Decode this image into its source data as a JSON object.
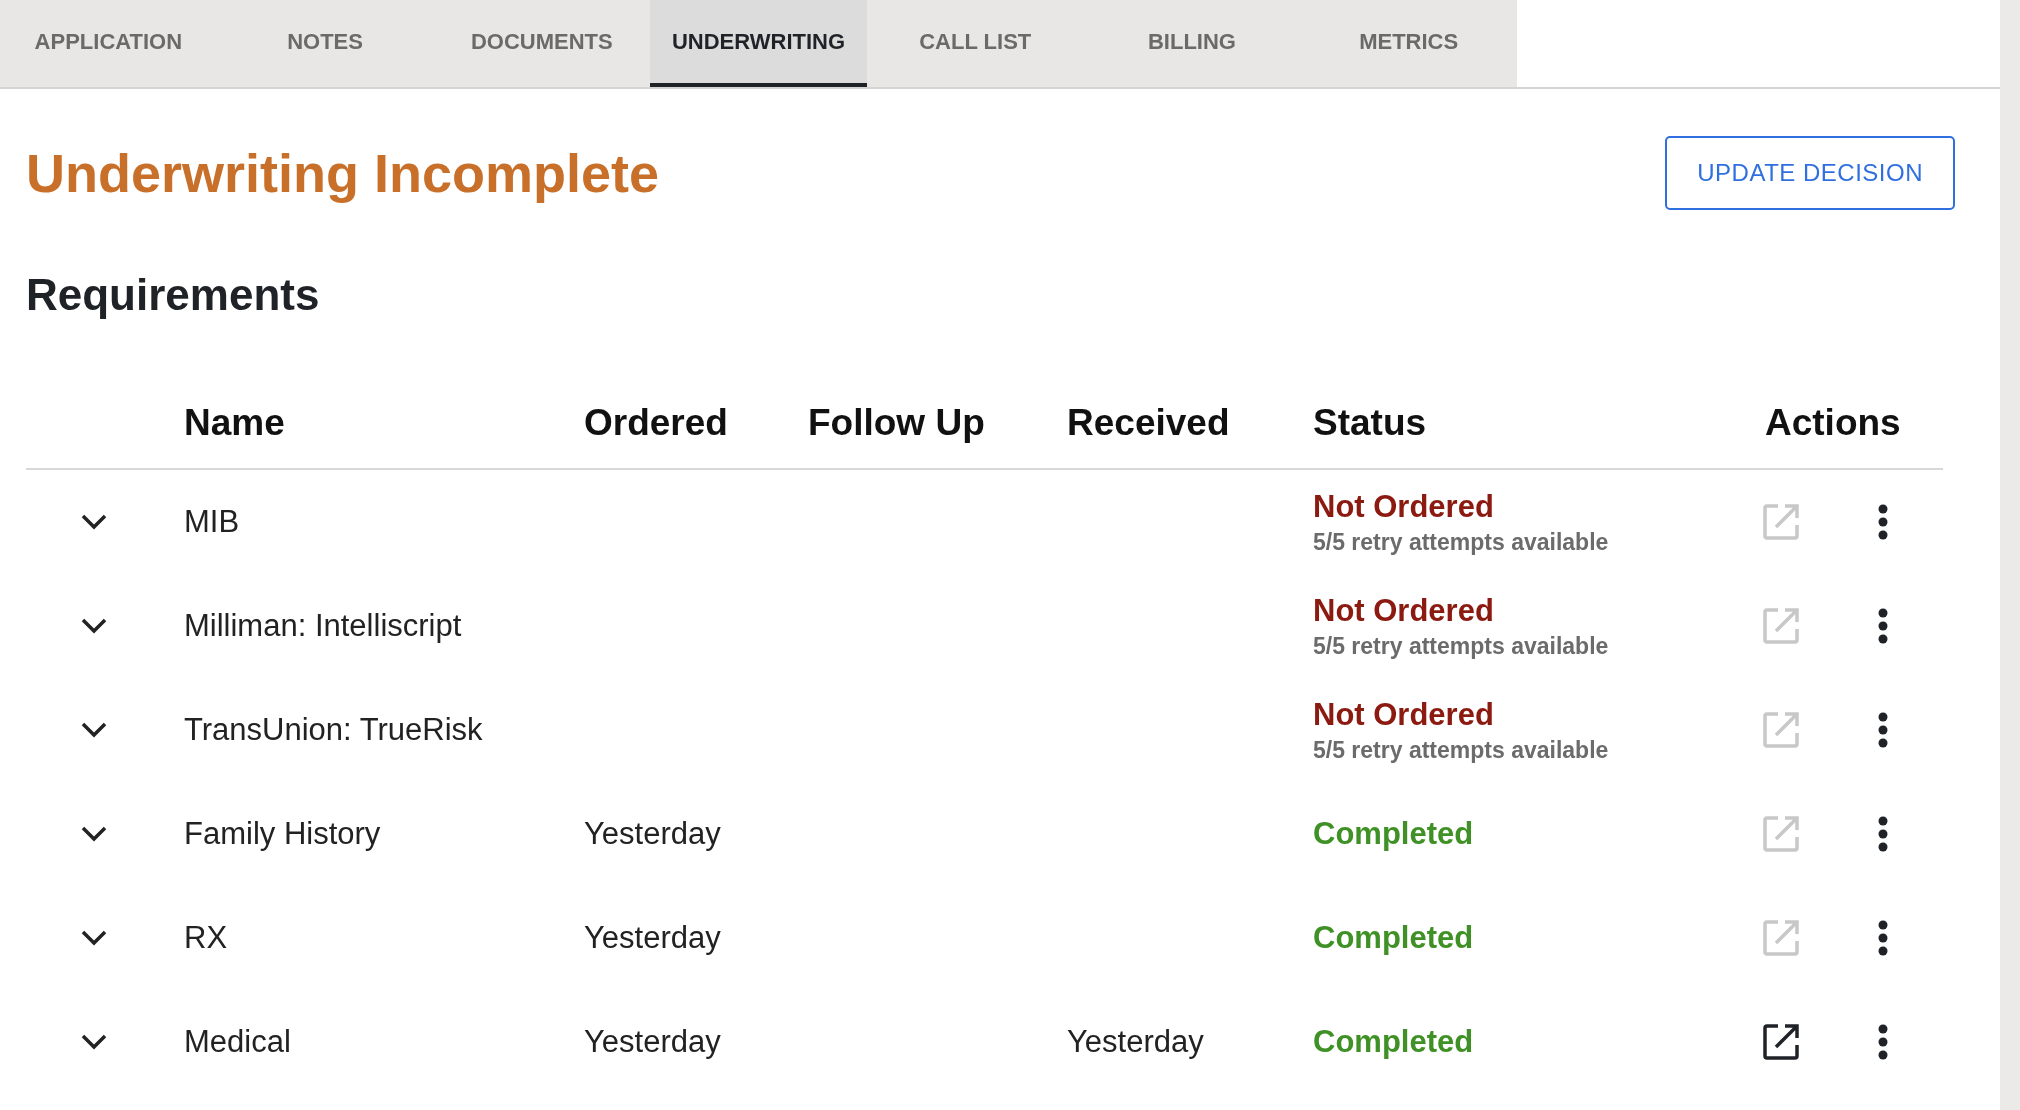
{
  "tabs": [
    {
      "label": "APPLICATION",
      "selected": false
    },
    {
      "label": "NOTES",
      "selected": false
    },
    {
      "label": "DOCUMENTS",
      "selected": false
    },
    {
      "label": "UNDERWRITING",
      "selected": true
    },
    {
      "label": "CALL LIST",
      "selected": false
    },
    {
      "label": "BILLING",
      "selected": false
    },
    {
      "label": "METRICS",
      "selected": false
    }
  ],
  "title": "Underwriting Incomplete",
  "update_button": "UPDATE DECISION",
  "section_title": "Requirements",
  "table": {
    "columns": [
      "Name",
      "Ordered",
      "Follow Up",
      "Received",
      "Status",
      "Actions"
    ],
    "rows": [
      {
        "name": "MIB",
        "status": "Not Ordered",
        "color": "#8b1a10",
        "note": "5/5 retry attempts available",
        "open_disabled": true
      },
      {
        "name": "Milliman: Intelliscript",
        "status": "Not Ordered",
        "color": "#8b1a10",
        "note": "5/5 retry attempts available",
        "open_disabled": true
      },
      {
        "name": "TransUnion: TrueRisk",
        "status": "Not Ordered",
        "color": "#8b1a10",
        "note": "5/5 retry attempts available",
        "open_disabled": true
      },
      {
        "name": "Family History",
        "ordered": "Yesterday",
        "status": "Completed",
        "color": "#3f9126",
        "open_disabled": true
      },
      {
        "name": "RX",
        "ordered": "Yesterday",
        "status": "Completed",
        "color": "#3f9126",
        "open_disabled": true
      },
      {
        "name": "Medical",
        "ordered": "Yesterday",
        "received": "Yesterday",
        "status": "Completed",
        "color": "#3f9126",
        "open_disabled": false
      }
    ]
  }
}
